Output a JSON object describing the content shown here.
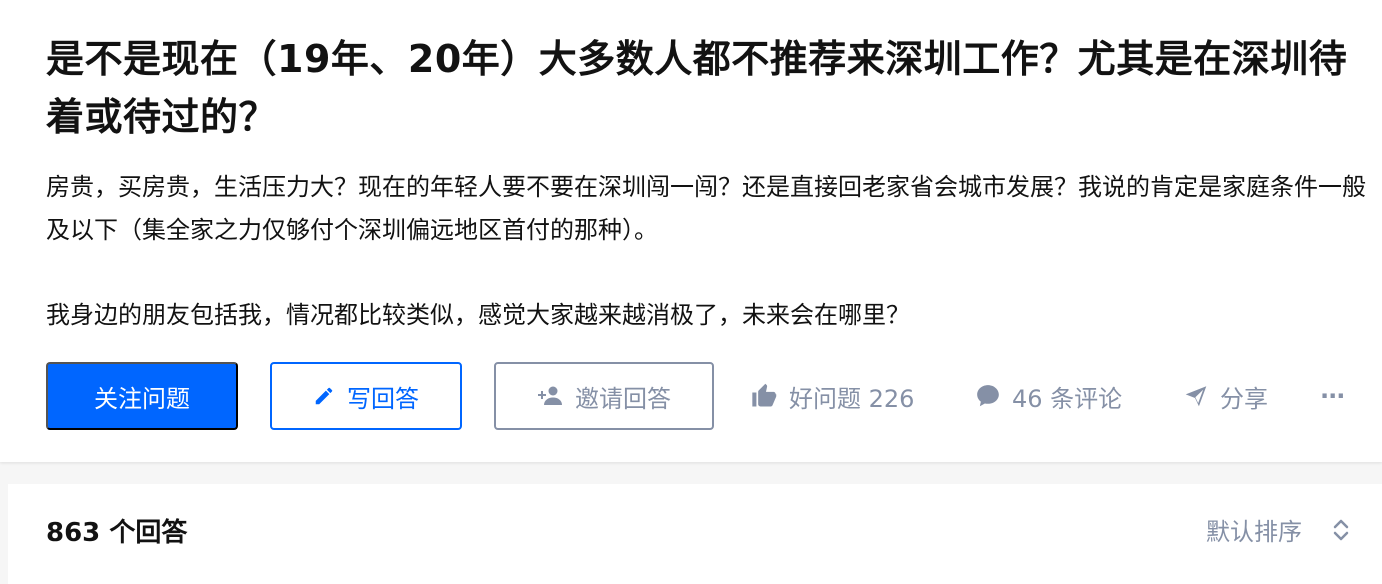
{
  "question": {
    "title": "是不是现在（19年、20年）大多数人都不推荐来深圳工作？尤其是在深圳待着或待过的？",
    "detail_para1": "房贵，买房贵，生活压力大？现在的年轻人要不要在深圳闯一闯？还是直接回老家省会城市发展？我说的肯定是家庭条件一般及以下（集全家之力仅够付个深圳偏远地区首付的那种）。",
    "detail_para2": "我身边的朋友包括我，情况都比较类似，感觉大家越来越消极了，未来会在哪里？"
  },
  "actions": {
    "follow_label": "关注问题",
    "write_answer_label": "写回答",
    "invite_label": "邀请回答",
    "good_question_label": "好问题 226",
    "comments_label": "46 条评论",
    "share_label": "分享",
    "more_label": "···"
  },
  "answers": {
    "count_label": "863 个回答",
    "sort_label": "默认排序"
  },
  "colors": {
    "primary": "#0066ff",
    "muted": "#8590a6",
    "text": "#121212"
  },
  "icons": {
    "write": "pencil-icon",
    "invite": "add-user-icon",
    "good": "thumbs-up-icon",
    "comment": "comment-bubble-icon",
    "share": "paper-plane-icon",
    "more": "more-dots-icon",
    "sort": "sort-updown-icon"
  }
}
